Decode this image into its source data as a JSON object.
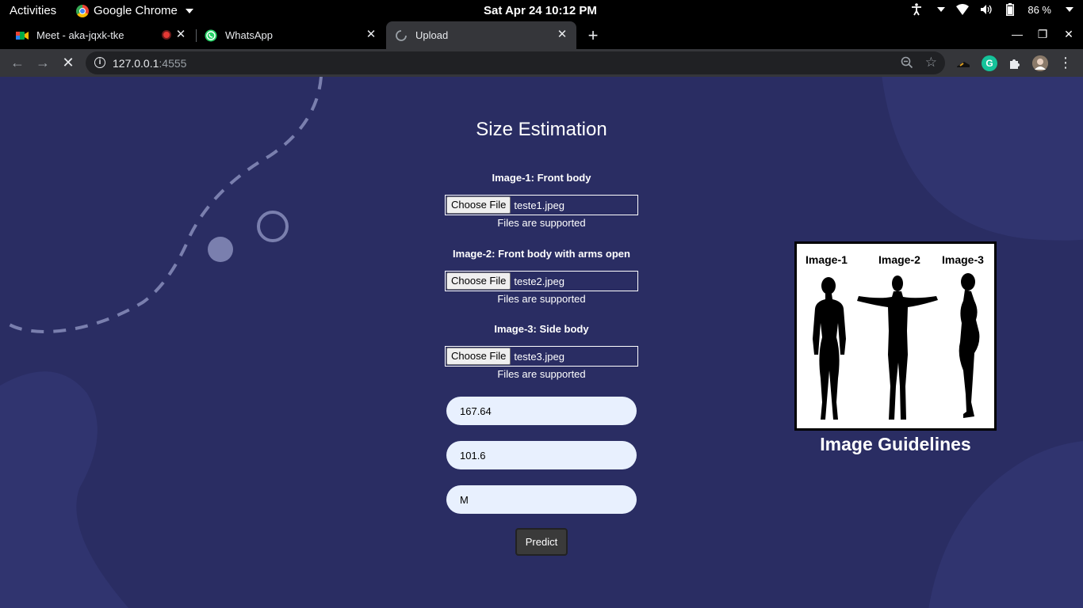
{
  "os_bar": {
    "activities": "Activities",
    "app_name": "Google Chrome",
    "clock": "Sat Apr 24  10:12 PM",
    "battery": "86 %"
  },
  "tabs": [
    {
      "title": "Meet - aka-jqxk-tke"
    },
    {
      "title": "WhatsApp"
    },
    {
      "title": "Upload"
    }
  ],
  "address_bar": {
    "host": "127.0.0.1",
    "port": ":4555"
  },
  "page": {
    "title": "Size Estimation",
    "uploads": [
      {
        "label": "Image-1: Front body",
        "button": "Choose File",
        "filename": "teste1.jpeg",
        "hint": "Files are supported"
      },
      {
        "label": "Image-2: Front body with arms open",
        "button": "Choose File",
        "filename": "teste2.jpeg",
        "hint": "Files are supported"
      },
      {
        "label": "Image-3: Side body",
        "button": "Choose File",
        "filename": "teste3.jpeg",
        "hint": "Files are supported"
      }
    ],
    "fields": [
      {
        "value": "167.64"
      },
      {
        "value": "101.6"
      },
      {
        "value": "M"
      }
    ],
    "predict_label": "Predict",
    "guidelines": {
      "labels": [
        "Image-1",
        "Image-2",
        "Image-3"
      ],
      "title": "Image Guidelines"
    }
  },
  "colors": {
    "page_bg": "#2a2d63",
    "input_bg": "#e8f0fe",
    "chrome_dark": "#35363a"
  }
}
